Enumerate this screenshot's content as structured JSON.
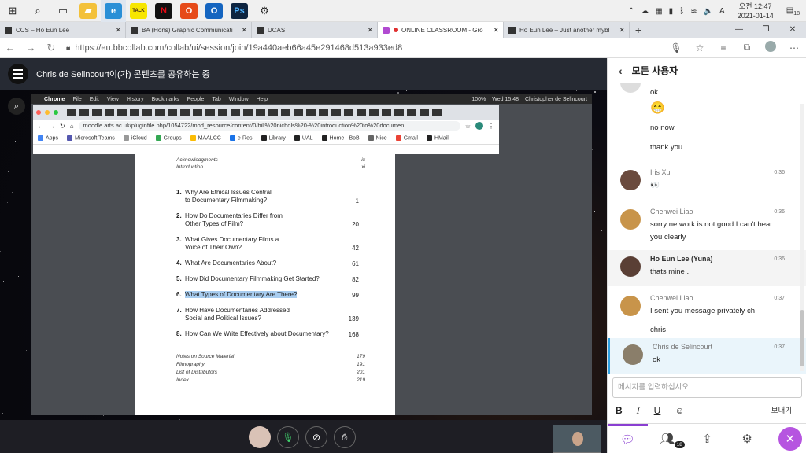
{
  "taskbar": {
    "apps": [
      {
        "name": "start-icon",
        "glyph": "⊞",
        "bg": "",
        "color": "#222"
      },
      {
        "name": "search-icon",
        "glyph": "⌕",
        "bg": "",
        "color": "#222"
      },
      {
        "name": "taskview-icon",
        "glyph": "▭",
        "bg": "",
        "color": "#222"
      },
      {
        "name": "file-explorer-icon",
        "glyph": "▰",
        "bg": "#f3c13a",
        "color": "#fff"
      },
      {
        "name": "edge-icon",
        "glyph": "e",
        "bg": "#2a8fd6",
        "color": "#fff"
      },
      {
        "name": "kakaotalk-icon",
        "glyph": "TALK",
        "bg": "#f7e600",
        "color": "#3b1e1e"
      },
      {
        "name": "netflix-icon",
        "glyph": "N",
        "bg": "#111",
        "color": "#e50914"
      },
      {
        "name": "office-icon",
        "glyph": "O",
        "bg": "#e64a19",
        "color": "#fff"
      },
      {
        "name": "outlook-icon",
        "glyph": "O",
        "bg": "#1565c0",
        "color": "#fff"
      },
      {
        "name": "photoshop-icon",
        "glyph": "Ps",
        "bg": "#0d2440",
        "color": "#4fb3ff"
      },
      {
        "name": "settings-icon",
        "glyph": "⚙",
        "bg": "",
        "color": "#222"
      }
    ],
    "tray": {
      "time": "오전 12:47",
      "date": "2021-01-14",
      "notification_count": "18"
    }
  },
  "browser": {
    "tabs": [
      {
        "title": "CCS – Ho Eun Lee",
        "active": false,
        "recording": false
      },
      {
        "title": "BA (Hons) Graphic Communicati",
        "active": false,
        "recording": false
      },
      {
        "title": "UCAS",
        "active": false,
        "recording": false
      },
      {
        "title": "ONLINE CLASSROOM - Gro",
        "active": true,
        "recording": true
      },
      {
        "title": "Ho Eun Lee – Just another mybl",
        "active": false,
        "recording": false
      }
    ],
    "url": "https://eu.bbcollab.com/collab/ui/session/join/19a440aeb66a45e291468d513a933ed8"
  },
  "collab": {
    "share_title": "Chris de Selincourt이(가) 콘텐츠를 공유하는 중"
  },
  "shared_screen": {
    "mac_menu": [
      "Chrome",
      "File",
      "Edit",
      "View",
      "History",
      "Bookmarks",
      "People",
      "Tab",
      "Window",
      "Help"
    ],
    "mac_status": {
      "battery": "100%",
      "clock": "Wed 15:48",
      "user": "Christopher de Selincourt"
    },
    "url": "moodle.arts.ac.uk/pluginfile.php/1054722/mod_resource/content/0/bill%20nichols%20-%20introduction%20to%20documen...",
    "bookmarks": [
      {
        "label": "Apps",
        "color": "#4285f4"
      },
      {
        "label": "Microsoft Teams",
        "color": "#5558af"
      },
      {
        "label": "iCloud",
        "color": "#999999"
      },
      {
        "label": "Groups",
        "color": "#34a853"
      },
      {
        "label": "MAALCC",
        "color": "#fbbc05"
      },
      {
        "label": "e-Res",
        "color": "#1a73e8"
      },
      {
        "label": "Library",
        "color": "#222222"
      },
      {
        "label": "UAL",
        "color": "#222222"
      },
      {
        "label": "Home · BoB",
        "color": "#222222"
      },
      {
        "label": "Nice",
        "color": "#666666"
      },
      {
        "label": "Gmail",
        "color": "#ea4335"
      },
      {
        "label": "HMail",
        "color": "#222222"
      }
    ],
    "toc": {
      "front": [
        {
          "title": "Acknowledgments",
          "page": "ix"
        },
        {
          "title": "Introduction",
          "page": "xi"
        }
      ],
      "chapters": [
        {
          "num": "1.",
          "lines": [
            "Why Are Ethical Issues Central",
            "to Documentary Filmmaking?"
          ],
          "page": "1",
          "highlight": false
        },
        {
          "num": "2.",
          "lines": [
            "How Do Documentaries Differ from",
            "Other Types of Film?"
          ],
          "page": "20",
          "highlight": false
        },
        {
          "num": "3.",
          "lines": [
            "What Gives Documentary Films a",
            "Voice of Their Own?"
          ],
          "page": "42",
          "highlight": false
        },
        {
          "num": "4.",
          "lines": [
            "What Are Documentaries About?"
          ],
          "page": "61",
          "highlight": false
        },
        {
          "num": "5.",
          "lines": [
            "How Did Documentary Filmmaking Get Started?"
          ],
          "page": "82",
          "highlight": false
        },
        {
          "num": "6.",
          "lines": [
            "What Types of Documentary Are There?"
          ],
          "page": "99",
          "highlight": true
        },
        {
          "num": "7.",
          "lines": [
            "How Have Documentaries Addressed",
            "Social and Political Issues?"
          ],
          "page": "139",
          "highlight": false
        },
        {
          "num": "8.",
          "lines": [
            "How Can We Write Effectively about Documentary?"
          ],
          "page": "168",
          "highlight": false
        }
      ],
      "back": [
        {
          "title": "Notes on Source Material",
          "page": "179"
        },
        {
          "title": "Filmography",
          "page": "191"
        },
        {
          "title": "List of Distributors",
          "page": "201"
        },
        {
          "title": "Index",
          "page": "219"
        }
      ]
    }
  },
  "panel": {
    "header": "모든 사용자",
    "messages": [
      {
        "name": "",
        "time": "",
        "lines": [
          "ok"
        ],
        "avatar": "#dddddd",
        "style": ""
      },
      {
        "name": "",
        "time": "",
        "lines": [
          "😁",
          "no now",
          "thank you"
        ],
        "avatar": "",
        "style": ""
      },
      {
        "name": "Iris Xu",
        "time": "0:36",
        "lines": [
          "👀"
        ],
        "avatar": "#6b4b3e",
        "style": ""
      },
      {
        "name": "Chenwei Liao",
        "time": "0:36",
        "lines": [
          "sorry network is not good I can't hear",
          "you clearly"
        ],
        "avatar": "#c8944a",
        "style": ""
      },
      {
        "name": "Ho Eun Lee (Yuna)",
        "time": "0:36",
        "lines": [
          "thats mine .."
        ],
        "avatar": "#5a3f35",
        "style": "hover",
        "bold": true
      },
      {
        "name": "Chenwei Liao",
        "time": "0:37",
        "lines": [
          "I sent you message privately ch",
          "",
          "chris"
        ],
        "avatar": "#c8944a",
        "style": ""
      },
      {
        "name": "Chris de Selincourt",
        "time": "0:37",
        "lines": [
          "ok"
        ],
        "avatar": "#8a7e6a",
        "style": "highlight"
      }
    ],
    "compose_placeholder": "메시지를 입력하십시오.",
    "send_label": "보내기",
    "participant_count": "18",
    "colors": {
      "accent": "#8a3fd1",
      "highlight_border": "#2fa0e0"
    }
  }
}
